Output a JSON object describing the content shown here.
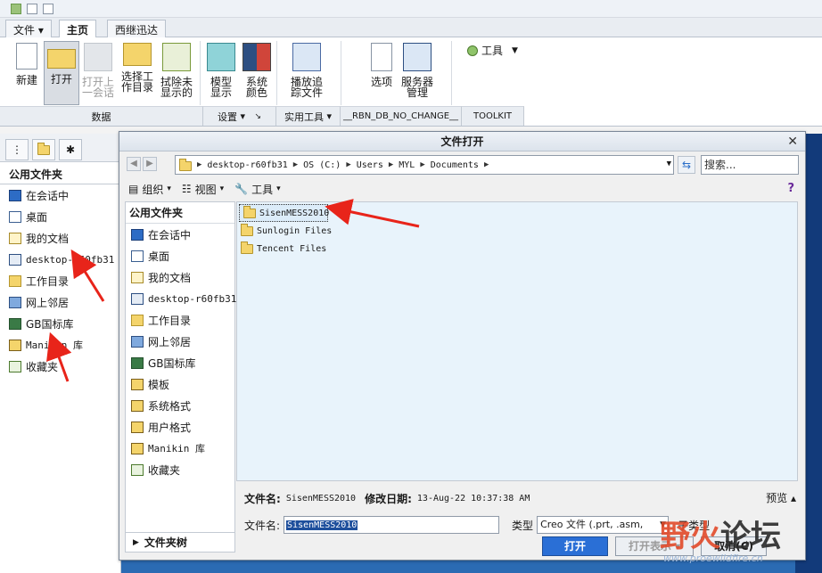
{
  "ribbon": {
    "tabs": [
      "文件",
      "主页",
      "西继迅达"
    ],
    "buttons": {
      "new": "新建",
      "open": "打开",
      "open_session": "打开上\n一会话",
      "select_workdir": "选择工\n作目录",
      "erase_undisplayed": "拭除未\n显示的",
      "model_display": "模型\n显示",
      "system_colors": "系统\n颜色",
      "play_trail": "播放追\n踪文件",
      "options": "选项",
      "server_mgmt": "服务器\n管理",
      "tools": "工具"
    },
    "groups": {
      "data": "数据",
      "settings": "设置",
      "utilities": "实用工具",
      "rbn": "__RBN_DB_NO_CHANGE__",
      "toolkit": "TOOLKIT"
    }
  },
  "navigator": {
    "title": "公用文件夹",
    "items": [
      "在会话中",
      "桌面",
      "我的文档",
      "desktop-r60fb31",
      "工作目录",
      "网上邻居",
      "GB国标库",
      "Manikin 库",
      "收藏夹"
    ]
  },
  "dialog": {
    "title": "文件打开",
    "breadcrumb": [
      "desktop-r60fb31",
      "OS (C:)",
      "Users",
      "MYL",
      "Documents"
    ],
    "search_placeholder": "搜索...",
    "toolbar": {
      "organize": "组织",
      "views": "视图",
      "tools": "工具"
    },
    "left_title": "公用文件夹",
    "left_items": [
      "在会话中",
      "桌面",
      "我的文档",
      "desktop-r60fb31",
      "工作目录",
      "网上邻居",
      "GB国标库",
      "模板",
      "系统格式",
      "用户格式",
      "Manikin 库",
      "收藏夹"
    ],
    "folder_tree": "文件夹树",
    "files": [
      "SisenMESS2010",
      "Sunlogin Files",
      "Tencent Files"
    ],
    "info": {
      "name_label": "文件名:",
      "name_value": "SisenMESS2010",
      "modified_label": "修改日期:",
      "modified_value": "13-Aug-22 10:37:38 AM",
      "preview": "预览"
    },
    "filename_label": "文件名:",
    "filename_value": "SisenMESS2010",
    "type_label": "类型",
    "type_value": "Creo 文件 (.prt, .asm,",
    "sub_type": "子类型",
    "buttons": {
      "open": "打开",
      "open_rep": "打开表示",
      "cancel": "取消(C)"
    }
  },
  "watermark": {
    "text": "野火论坛",
    "url": "www.proewildfire.cn"
  },
  "colors": {
    "accent": "#2a6fd6",
    "annotation": "#e8241a",
    "desktop": "#2b6bb3"
  }
}
